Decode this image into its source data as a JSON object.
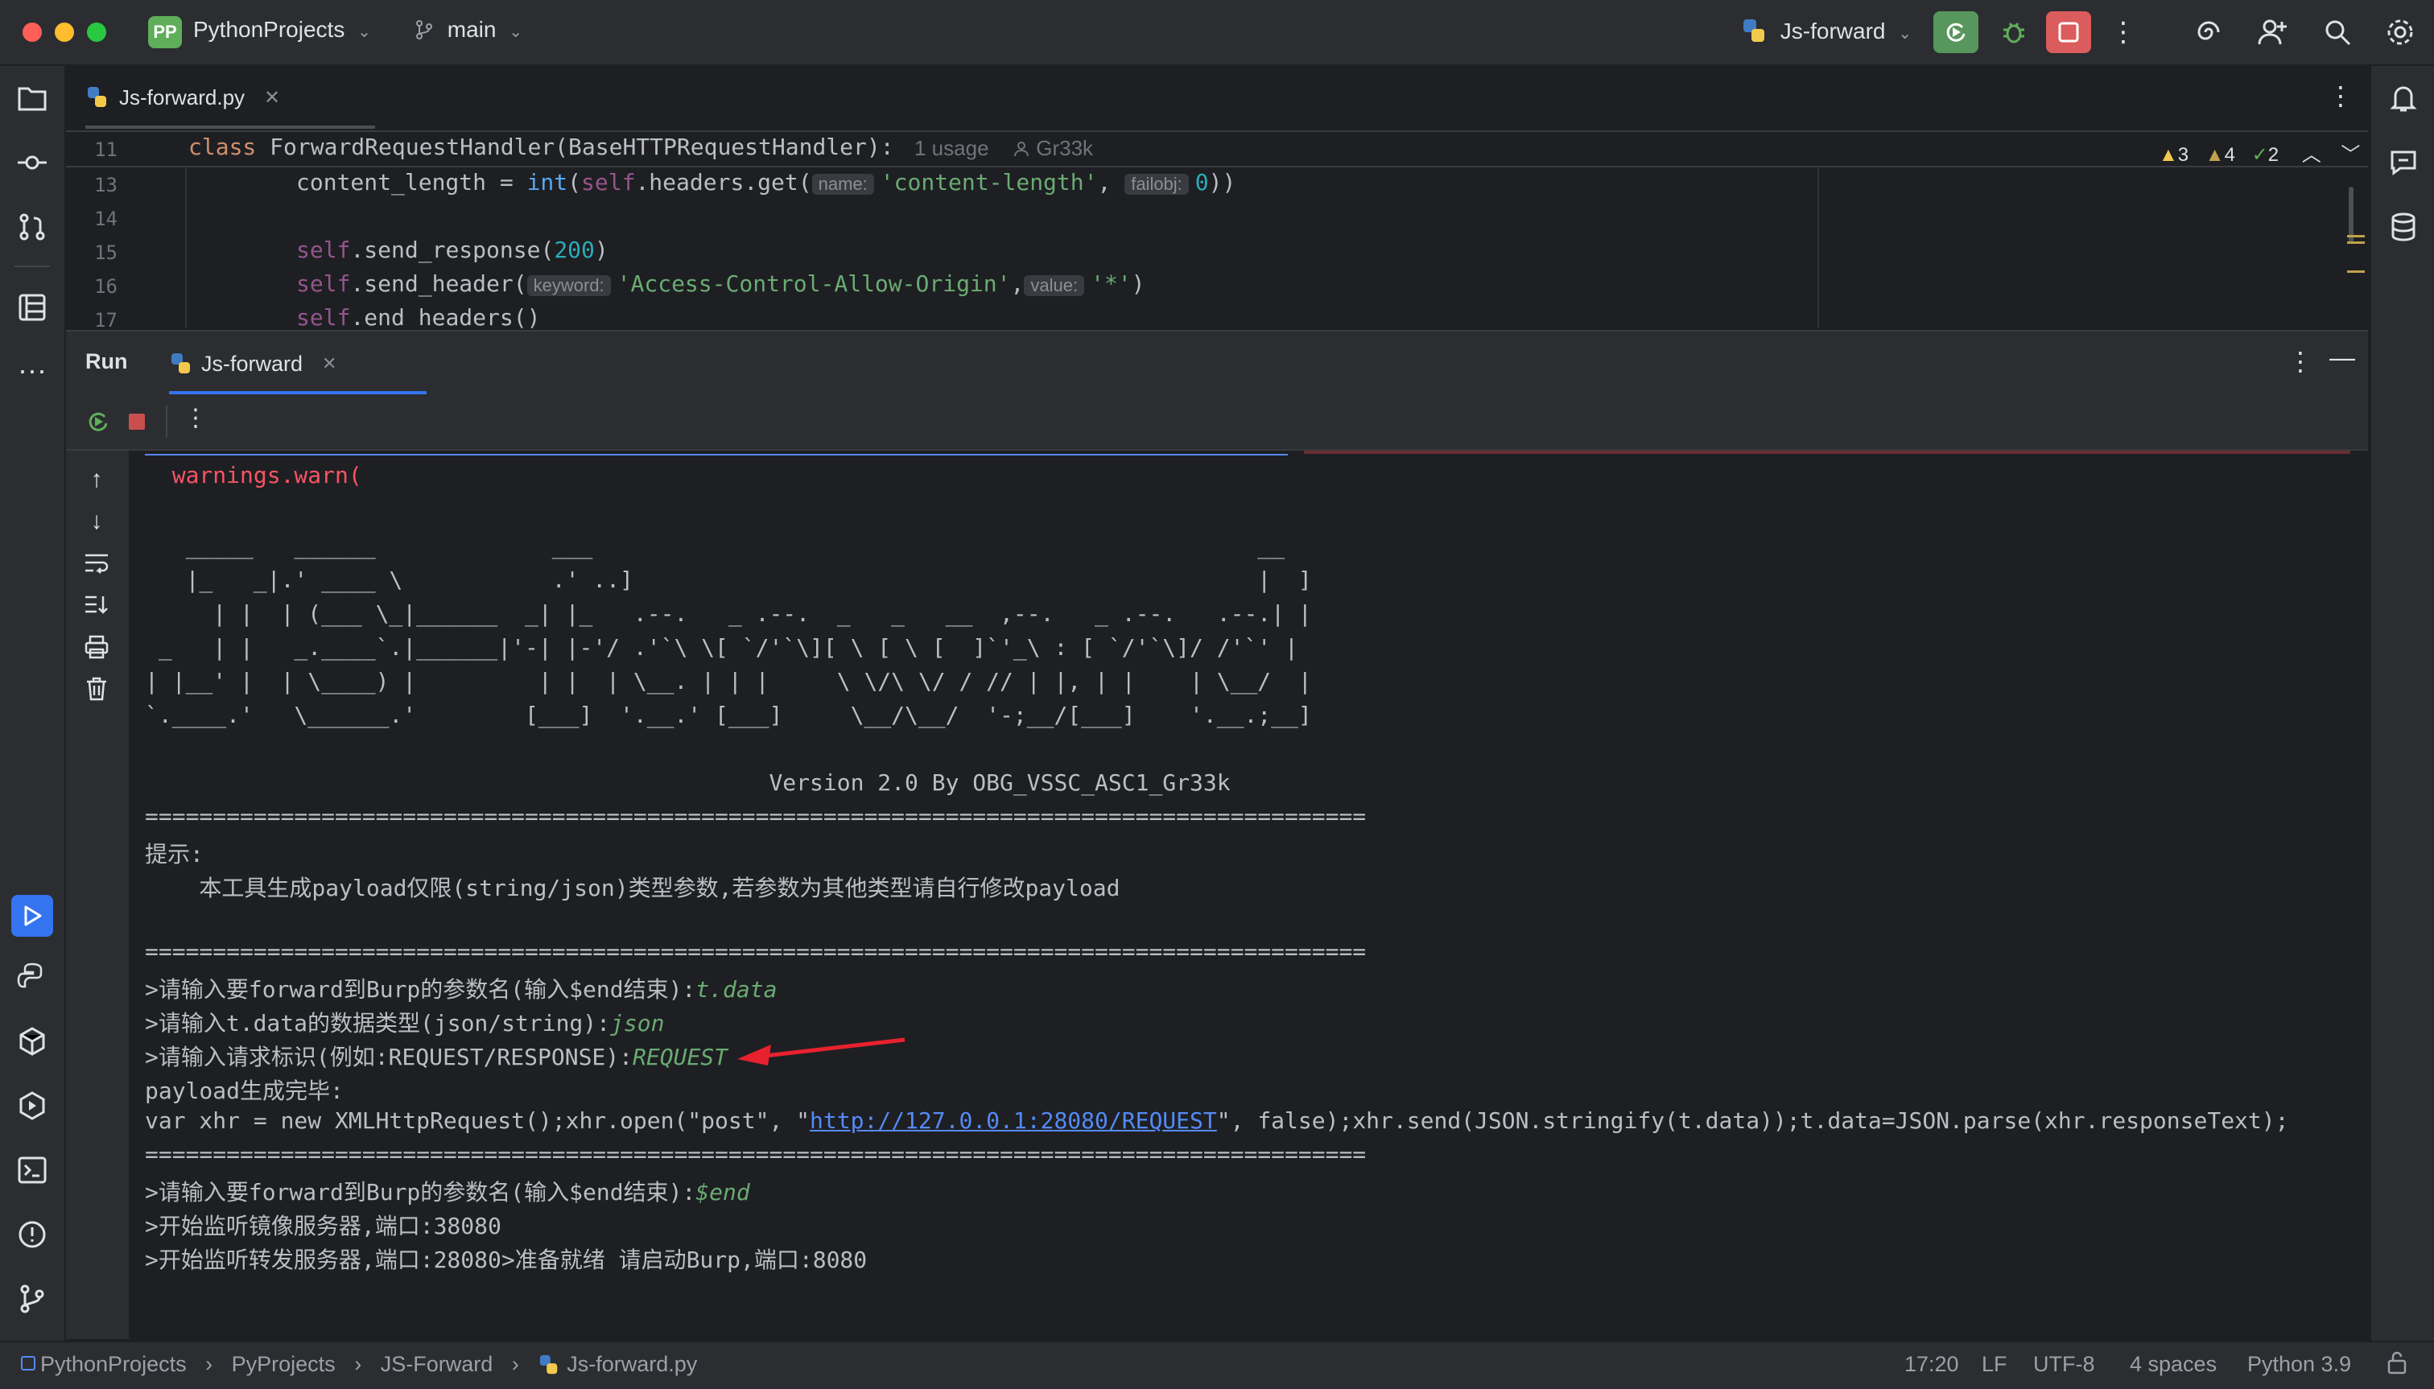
{
  "titlebar": {
    "project_badge": "PP",
    "project_name": "PythonProjects",
    "branch": "main",
    "run_config": "Js-forward"
  },
  "editor": {
    "tab_label": "Js-forward.py",
    "sticky_line_num": "11",
    "sticky_code": "class ForwardRequestHandler(BaseHTTPRequestHandler):",
    "sticky_usage": "1 usage",
    "sticky_author": "Gr33k",
    "warnings": "3",
    "weak_warnings": "4",
    "ok_count": "2",
    "lines": [
      {
        "num": "13"
      },
      {
        "num": "14"
      },
      {
        "num": "15"
      },
      {
        "num": "16"
      },
      {
        "num": "17"
      }
    ],
    "hints": {
      "name": "name:",
      "failobj": "failobj:",
      "keyword": "keyword:",
      "value": "value:"
    }
  },
  "run": {
    "title": "Run",
    "tab_label": "Js-forward"
  },
  "console": {
    "lines": [
      "  warnings.warn(",
      "",
      "",
      "   _____   ______             ___                                                 __",
      "   |_   _|.' ____ \\           .' ..]                                              |  ]",
      "     | |  | (___ \\_|______  _| |_   .--.   _ .--.  _   _   __  ,--.   _ .--.   .--.| |",
      " _   | |   _.____`.|______|'-| |-'/ .'`\\ \\[ `/'`\\][ \\ [ \\ [  ]`'_\\ : [ `/'`\\]/ /'`' |",
      "| |__' |  | \\____) |         | |  | \\__. | | |     \\ \\/\\ \\/ / // | |, | |    | \\__/  |",
      "`.____.'   \\______.'        [___]  '.__.' [___]     \\__/\\__/  '-;__/[___]    '.__.;__]",
      "",
      "                                              Version 2.0 By OBG_VSSC_ASC1_Gr33k",
      "==========================================================================================",
      "提示:",
      "    本工具生成payload仅限(string/json)类型参数,若参数为其他类型请自行修改payload",
      "",
      "=========================================================================================="
    ],
    "prompt1": ">请输入要forward到Burp的参数名(输入$end结束):",
    "input1": "t.data",
    "prompt2": ">请输入t.data的数据类型(json/string):",
    "input2": "json",
    "prompt3": ">请输入请求标识(例如:REQUEST/RESPONSE):",
    "input3": "REQUEST",
    "payload_done": "payload生成完毕:",
    "payload_pre": "var xhr = new XMLHttpRequest();xhr.open(\"post\", \"",
    "payload_link": "http://127.0.0.1:28080/REQUEST",
    "payload_post": "\", false);xhr.send(JSON.stringify(t.data));t.data=JSON.parse(xhr.responseText);",
    "sep": "==========================================================================================",
    "prompt4": ">请输入要forward到Burp的参数名(输入$end结束):",
    "input4": "$end",
    "mirror": ">开始监听镜像服务器,端口:38080",
    "forward": ">开始监听转发服务器,端口:28080>准备就绪 请启动Burp,端口:8080"
  },
  "statusbar": {
    "crumbs": [
      "PythonProjects",
      "PyProjects",
      "JS-Forward",
      "Js-forward.py"
    ],
    "position": "17:20",
    "line_sep": "LF",
    "encoding": "UTF-8",
    "indent": "4 spaces",
    "interpreter": "Python 3.9"
  },
  "colors": {
    "accent": "#3574f0",
    "run_green": "#57965c",
    "stop_red": "#db5c5c",
    "error_red": "#f75464",
    "input_green": "#6aab73"
  }
}
